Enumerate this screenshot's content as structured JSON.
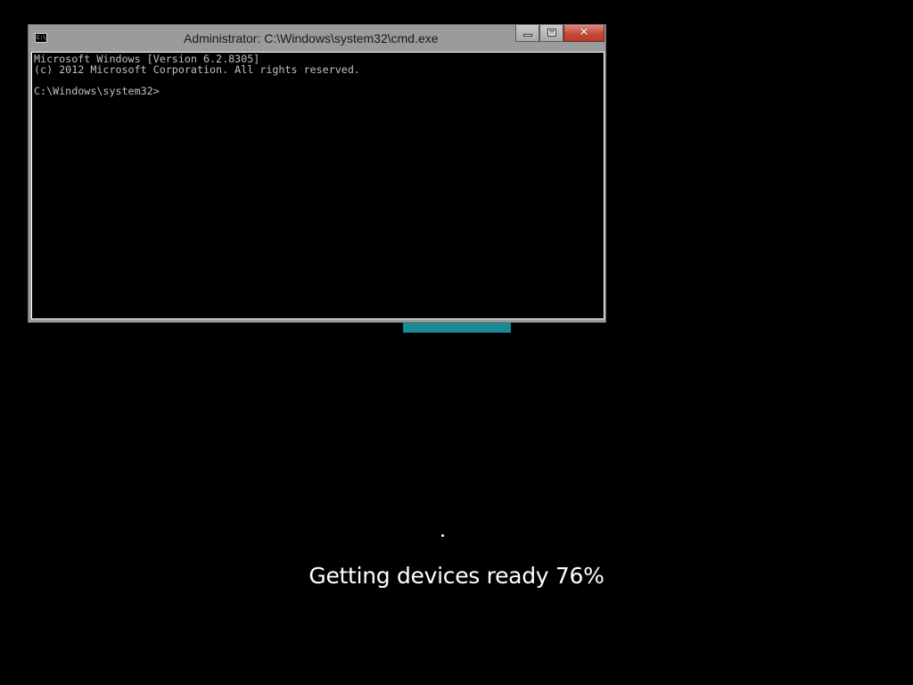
{
  "window": {
    "title": "Administrator: C:\\Windows\\system32\\cmd.exe",
    "icon": "cmd-icon",
    "icon_text": "C:\\",
    "controls": {
      "minimize_icon": "minimize-icon",
      "maximize_icon": "maximize-icon",
      "close_icon": "close-icon",
      "close_glyph": "✕"
    }
  },
  "console": {
    "lines": [
      "Microsoft Windows [Version 6.2.8305]",
      "(c) 2012 Microsoft Corporation. All rights reserved.",
      "",
      "C:\\Windows\\system32>"
    ],
    "text_color": "#c0c0c0",
    "background_color": "#000000"
  },
  "setup": {
    "status": "Getting devices ready 76%",
    "progress_percent": 76,
    "accent_color": "#178a93"
  }
}
